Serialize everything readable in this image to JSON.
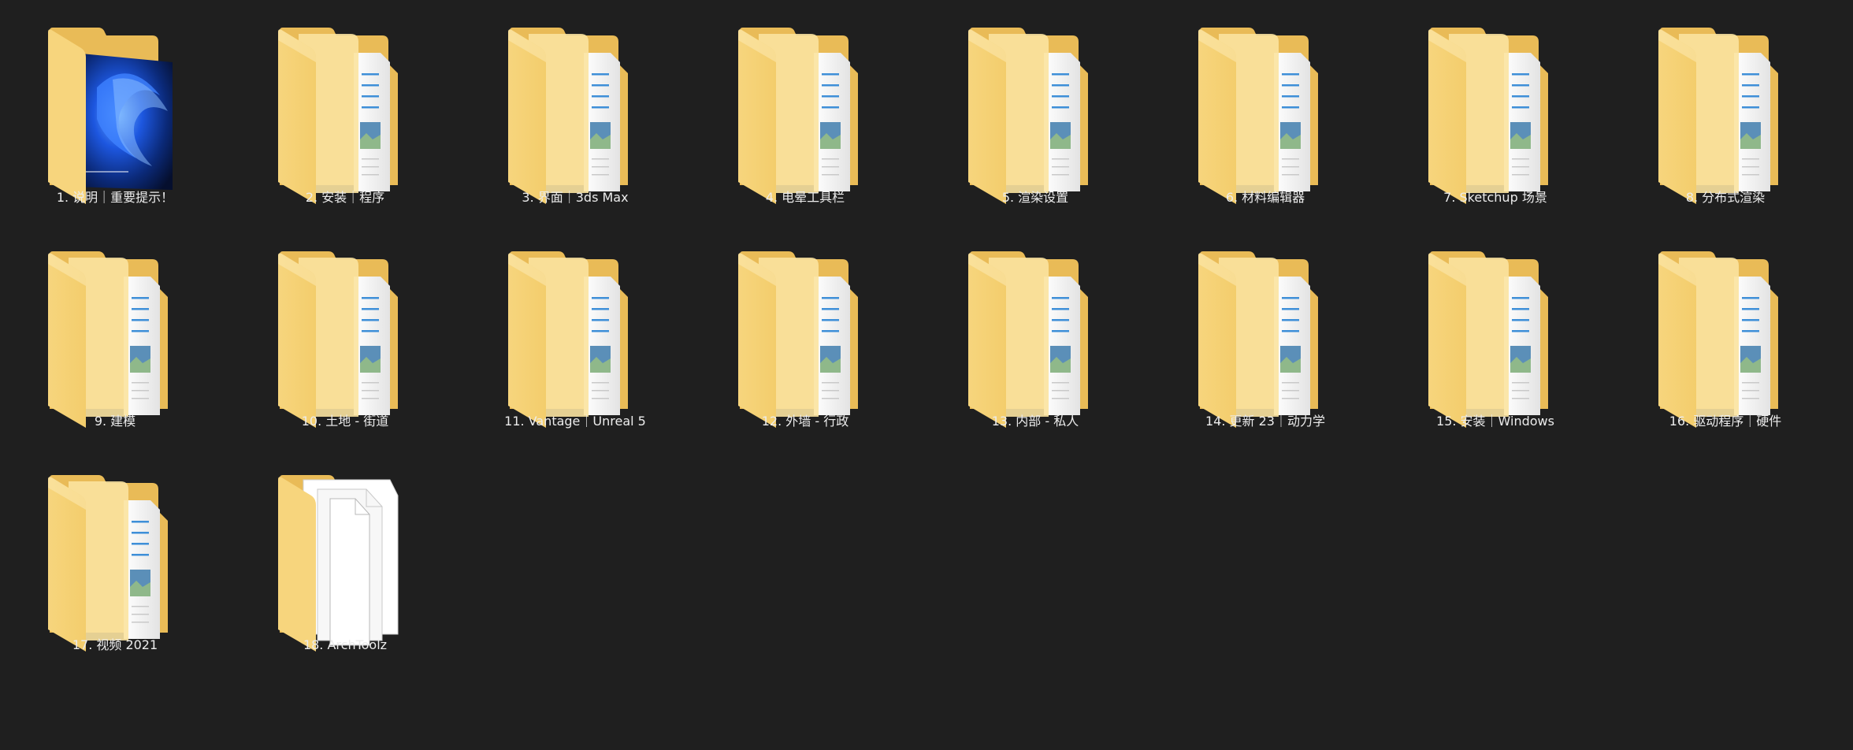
{
  "window": {
    "view": "large-icons",
    "background": "#1f1f1f"
  },
  "folders": [
    {
      "label": "1. 说明｜重要提示！",
      "preview": "wallpaper"
    },
    {
      "label": "2. 安装｜程序",
      "preview": "document"
    },
    {
      "label": "3. 界面｜3ds Max",
      "preview": "document"
    },
    {
      "label": "4. 电晕工具栏",
      "preview": "document"
    },
    {
      "label": "5. 渲染设置",
      "preview": "document"
    },
    {
      "label": "6. 材料编辑器",
      "preview": "document"
    },
    {
      "label": "7. Sketchup 场景",
      "preview": "document"
    },
    {
      "label": "8. 分布式渲染",
      "preview": "document"
    },
    {
      "label": "9. 建模",
      "preview": "document"
    },
    {
      "label": "10. 土地 - 街道",
      "preview": "document"
    },
    {
      "label": "11. Vantage｜Unreal 5",
      "preview": "document"
    },
    {
      "label": "12. 外墙 - 行政",
      "preview": "document"
    },
    {
      "label": "13. 内部 - 私人",
      "preview": "document"
    },
    {
      "label": "14. 更新 23｜动力学",
      "preview": "document"
    },
    {
      "label": "15. 安装｜Windows",
      "preview": "document"
    },
    {
      "label": "16. 驱动程序｜硬件",
      "preview": "document"
    },
    {
      "label": "17. 视频 2021",
      "preview": "document"
    },
    {
      "label": "18. ArchToolz",
      "preview": "blank-pages"
    }
  ],
  "colors": {
    "folder_back": "#e9bb57",
    "folder_front": "#f7d57d",
    "folder_light": "#fbe3a0",
    "paper": "#f4f4f4",
    "doc_lines": "#3e8fd8",
    "label_text": "#ececec"
  }
}
